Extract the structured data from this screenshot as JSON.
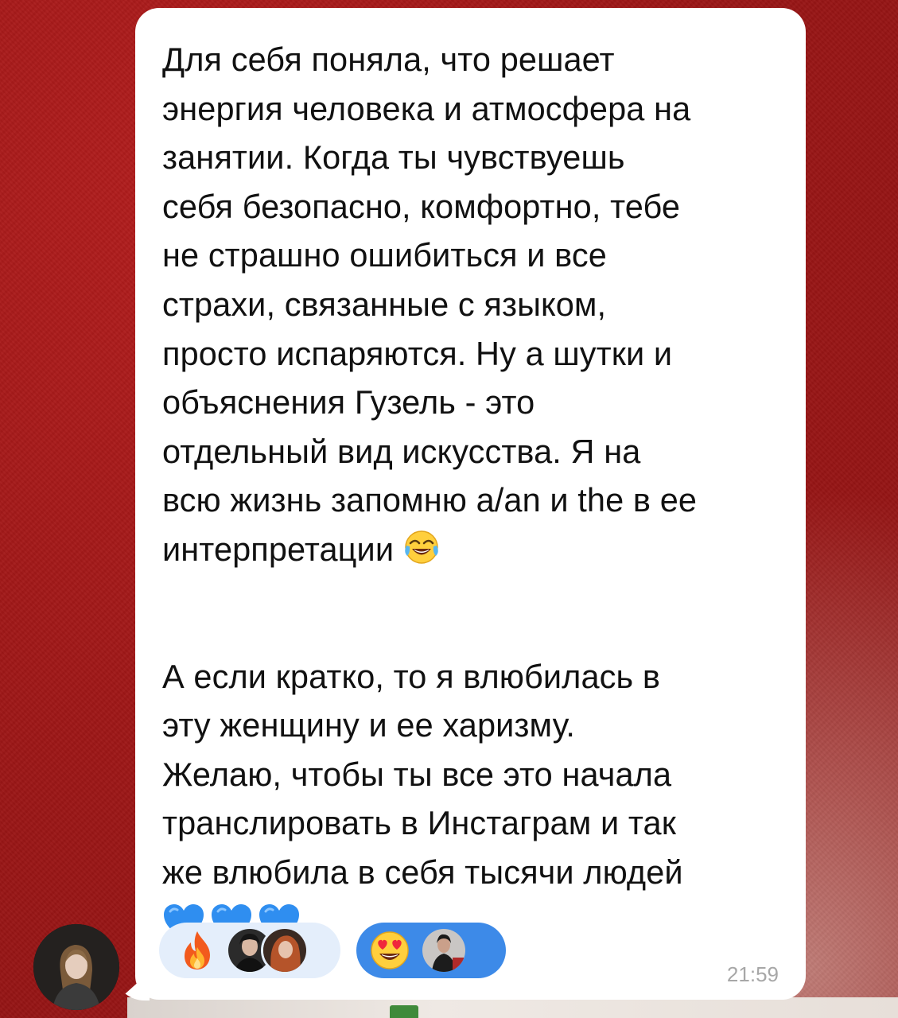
{
  "message": {
    "paragraph_lines": [
      "Для себя поняла, что решает",
      "энергия человека и атмосфера на",
      "занятии. Когда ты чувствуешь",
      "себя безопасно, комфортно, тебе",
      "не страшно ошибиться и все",
      "страхи, связанные с языком,",
      "просто испаряются. Ну а шутки и",
      "объяснения Гузель - это",
      "отдельный вид искусства. Я на",
      "всю жизнь запомню a/an и the в ее",
      "интерпретации"
    ],
    "paragraph2_lines": [
      "А если кратко, то я влюбилась в",
      "эту женщину и ее харизму.",
      "Желаю, чтобы ты все это начала",
      "транслировать в Инстаграм и так",
      "же влюбила в себя тысячи людей"
    ],
    "inline_emoji": "face-with-tears-of-joy",
    "trailing_emoji": [
      "blue-heart",
      "blue-heart",
      "blue-heart"
    ],
    "timestamp": "21:59"
  },
  "reactions": [
    {
      "emoji": "fire",
      "reactors": 2,
      "selected_by_me": false
    },
    {
      "emoji": "heart-eyes",
      "reactors": 1,
      "selected_by_me": true
    }
  ],
  "colors": {
    "background": "#9e1717",
    "bubble": "#ffffff",
    "reaction_other": "#e4eefb",
    "reaction_mine": "#3d8ae8",
    "timestamp": "#a7a7a7",
    "heart": "#2f8ef0"
  }
}
